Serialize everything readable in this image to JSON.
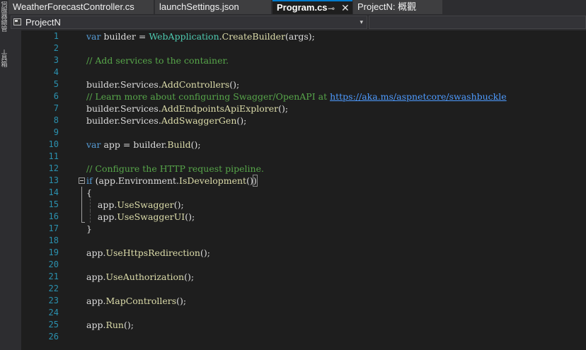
{
  "side_strip": {
    "tab1": "伺服器總管",
    "tab2": "工具箱"
  },
  "tabs": [
    {
      "label": "WeatherForecastController.cs"
    },
    {
      "label": "launchSettings.json"
    },
    {
      "label": "Program.cs"
    },
    {
      "label": "ProjectN: 概觀"
    }
  ],
  "tab_pin_glyph": "⊸",
  "tab_close_glyph": "✕",
  "nav": {
    "project": "ProjectN",
    "dropdown_glyph": "▾"
  },
  "line_numbers": [
    "1",
    "2",
    "3",
    "4",
    "5",
    "6",
    "7",
    "8",
    "9",
    "10",
    "11",
    "12",
    "13",
    "14",
    "15",
    "16",
    "17",
    "18",
    "19",
    "20",
    "21",
    "22",
    "23",
    "24",
    "25",
    "26"
  ],
  "code": {
    "l1": {
      "kw": "var",
      "a": " builder = ",
      "ty": "WebApplication",
      "b": ".",
      "m": "CreateBuilder",
      "c": "(args);"
    },
    "l3": "// Add services to the container.",
    "l5": {
      "a": "builder.Services.",
      "m": "AddControllers",
      "b": "();"
    },
    "l6": {
      "text": "// Learn more about configuring Swagger/OpenAPI at ",
      "link": "https://aka.ms/aspnetcore/swashbuckle"
    },
    "l7": {
      "a": "builder.Services.",
      "m": "AddEndpointsApiExplorer",
      "b": "();"
    },
    "l8": {
      "a": "builder.Services.",
      "m": "AddSwaggerGen",
      "b": "();"
    },
    "l10": {
      "kw": "var",
      "a": " app = builder.",
      "m": "Build",
      "b": "();"
    },
    "l12": "// Configure the HTTP request pipeline.",
    "l13": {
      "kw": "if",
      "open": " (",
      "a": "app.Environment.",
      "m": "IsDevelopment",
      "b": "()",
      "close": ")"
    },
    "l14": "{",
    "l15": {
      "a": "    app.",
      "m": "UseSwagger",
      "b": "();"
    },
    "l16": {
      "a": "    app.",
      "m": "UseSwaggerUI",
      "b": "();"
    },
    "l17": "}",
    "l19": {
      "a": "app.",
      "m": "UseHttpsRedirection",
      "b": "();"
    },
    "l21": {
      "a": "app.",
      "m": "UseAuthorization",
      "b": "();"
    },
    "l23": {
      "a": "app.",
      "m": "MapControllers",
      "b": "();"
    },
    "l25": {
      "a": "app.",
      "m": "Run",
      "b": "();"
    }
  },
  "colors": {
    "keyword": "#569cd6",
    "type": "#4ec9b0",
    "method": "#dcdcaa",
    "comment": "#57a64a",
    "line_number": "#2b91af",
    "link": "#4e9bff",
    "accent": "#007acc"
  }
}
